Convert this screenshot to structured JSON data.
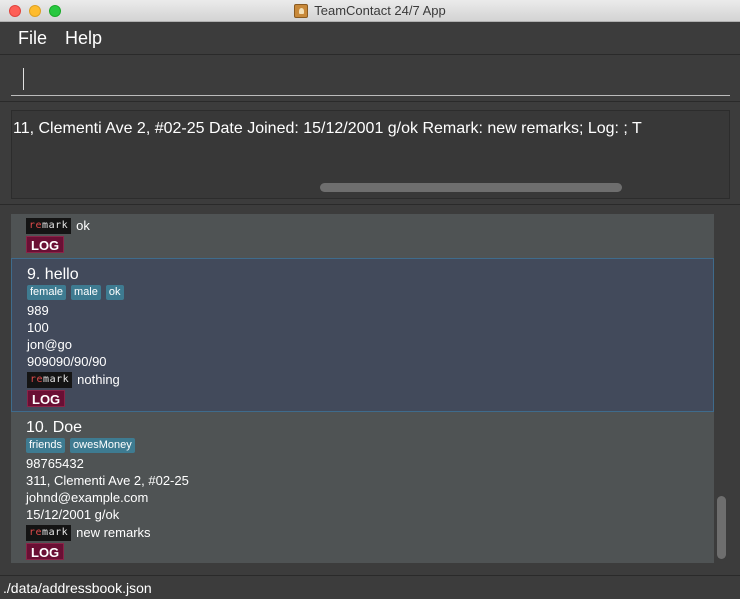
{
  "window": {
    "title": "TeamContact 24/7 App"
  },
  "menu": {
    "file": "File",
    "help": "Help"
  },
  "command": {
    "value": "",
    "placeholder": ""
  },
  "result": {
    "text": "11, Clementi Ave 2, #02-25 Date Joined: 15/12/2001 g/ok Remark: new remarks; Log: ; T"
  },
  "person_list": {
    "partial_top": {
      "remark": "ok",
      "log_label": "LOG",
      "remark_badge": "remark"
    },
    "cards": [
      {
        "index_name": "9.  hello",
        "tags": [
          "female",
          "male",
          "ok"
        ],
        "phone": "989",
        "field2": "100",
        "email": "jon@go",
        "date": "909090/90/90",
        "remark_badge": "remark",
        "remark": "nothing",
        "log_label": "LOG",
        "selected": true
      },
      {
        "index_name": "10.  Doe",
        "tags": [
          "friends",
          "owesMoney"
        ],
        "phone": "98765432",
        "address": "311, Clementi Ave 2, #02-25",
        "email": "johnd@example.com",
        "date": "15/12/2001 g/ok",
        "remark_badge": "remark",
        "remark": "new remarks",
        "log_label": "LOG",
        "selected": false
      }
    ]
  },
  "status": {
    "path": "./data/addressbook.json"
  },
  "colors": {
    "background": "#3c3c3c",
    "list_panel": "#4f5354",
    "selected_card": "#424a5b",
    "tag": "#3e7b91",
    "log_badge": "#6a0f34"
  }
}
